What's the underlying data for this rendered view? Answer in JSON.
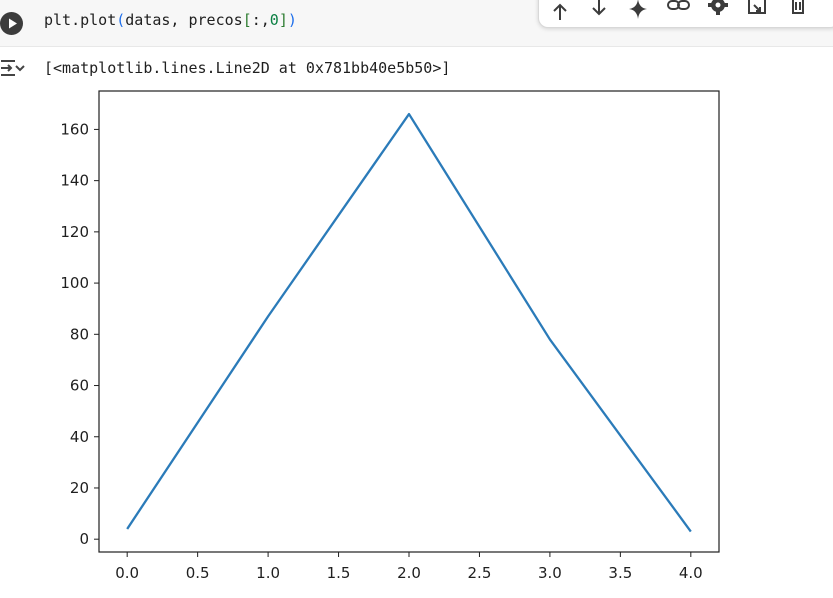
{
  "cell": {
    "code_tokens": [
      {
        "text": "plt.plot",
        "cls": ""
      },
      {
        "text": "(",
        "cls": "tok-paren"
      },
      {
        "text": "datas, precos",
        "cls": ""
      },
      {
        "text": "[",
        "cls": "tok-bracket"
      },
      {
        "text": ":,",
        "cls": ""
      },
      {
        "text": "0",
        "cls": "tok-num"
      },
      {
        "text": "]",
        "cls": "tok-bracket"
      },
      {
        "text": ")",
        "cls": "tok-paren"
      }
    ]
  },
  "toolbar": {
    "icons": [
      "arrow-up-icon",
      "arrow-down-icon",
      "sparkle-icon",
      "link-icon",
      "gear-icon",
      "mirror-cell-icon",
      "delete-icon"
    ]
  },
  "output": {
    "repr": "[<matplotlib.lines.Line2D at 0x781bb40e5b50>]"
  },
  "chart_data": {
    "type": "line",
    "x": [
      0.0,
      1.0,
      2.0,
      3.0,
      4.0
    ],
    "series": [
      {
        "values": [
          4,
          87,
          166,
          78,
          3
        ],
        "color": "#2b7bb9"
      }
    ],
    "xlim": [
      -0.2,
      4.2
    ],
    "ylim": [
      -5,
      175
    ],
    "xticks": [
      "0.0",
      "0.5",
      "1.0",
      "1.5",
      "2.0",
      "2.5",
      "3.0",
      "3.5",
      "4.0"
    ],
    "yticks": [
      "0",
      "20",
      "40",
      "60",
      "80",
      "100",
      "120",
      "140",
      "160"
    ],
    "grid": false
  }
}
